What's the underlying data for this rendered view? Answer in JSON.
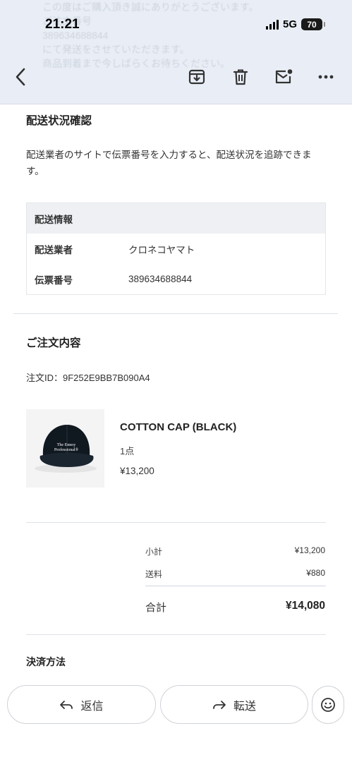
{
  "status_bar": {
    "time": "21:21",
    "network": "5G",
    "battery": "70"
  },
  "header": {
    "ghost_lines": [
      "この度はご購入頂き誠にありがとうございます。",
      "ご注文番号",
      "389634688844",
      "にて発送をさせていただきます。",
      "商品到着まで今しばらくお待ちください。"
    ]
  },
  "shipping": {
    "title": "配送状況確認",
    "description": "配送業者のサイトで伝票番号を入力すると、配送状況を追跡できます。",
    "table_header": "配送情報",
    "rows": [
      {
        "label": "配送業者",
        "value": "クロネコヤマト"
      },
      {
        "label": "伝票番号",
        "value": "389634688844"
      }
    ]
  },
  "order": {
    "title": "ご注文内容",
    "order_id": "注文ID：9F252E9BB7B090A4",
    "item": {
      "name": "COTTON CAP (BLACK)",
      "quantity": "1点",
      "price": "¥13,200",
      "image_text_line1": "The Ennoy",
      "image_text_line2": "Professional®"
    },
    "subtotal_label": "小計",
    "subtotal_value": "¥13,200",
    "shipping_label": "送料",
    "shipping_value": "¥880",
    "total_label": "合計",
    "total_value": "¥14,080"
  },
  "payment": {
    "title": "決済方法"
  },
  "bottom_bar": {
    "reply_label": "返信",
    "forward_label": "転送"
  }
}
